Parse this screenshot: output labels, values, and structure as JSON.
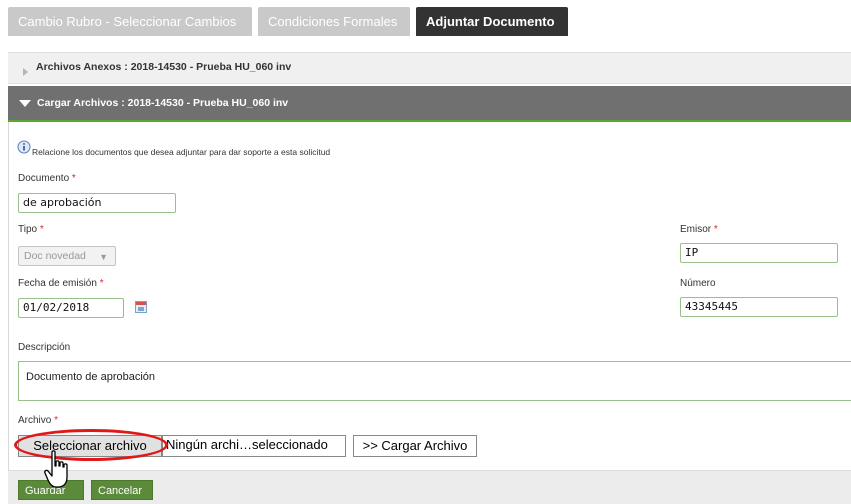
{
  "tabs": [
    {
      "label": "Cambio Rubro - Seleccionar Cambios",
      "active": false
    },
    {
      "label": "Condiciones Formales",
      "active": false
    },
    {
      "label": "Adjuntar Documento",
      "active": true
    }
  ],
  "sections": {
    "anexos_title": "Archivos Anexos : 2018-14530 - Prueba HU_060 inv",
    "cargar_title": "Cargar Archivos : 2018-14530 - Prueba HU_060 inv"
  },
  "info_text": "Relacione los documentos que desea adjuntar para dar soporte a esta solicitud",
  "required_marker": "*",
  "form": {
    "documento": {
      "label": "Documento",
      "value": "de aprobación"
    },
    "tipo": {
      "label": "Tipo",
      "value": "Doc novedad"
    },
    "emisor": {
      "label": "Emisor",
      "value": "IP"
    },
    "fecha": {
      "label": "Fecha de emisión",
      "value": "01/02/2018"
    },
    "numero": {
      "label": "Número",
      "value": "43345445"
    },
    "descripcion": {
      "label": "Descripción",
      "value": "Documento de aprobación"
    },
    "archivo": {
      "label": "Archivo",
      "select_button": "Seleccionar archivo",
      "status": "Ningún archi…seleccionado",
      "upload_button": ">> Cargar Archivo"
    }
  },
  "actions": {
    "save": "Guardar",
    "cancel": "Cancelar"
  },
  "colors": {
    "accent_green": "#5aa832",
    "button_green": "#5a8a3a",
    "highlight_red": "#e01818",
    "active_tab": "#333333"
  },
  "icons": [
    "info-icon",
    "calendar-icon",
    "hand-cursor-icon",
    "collapse-arrow-icon",
    "expand-arrow-icon",
    "chevron-down-icon"
  ]
}
